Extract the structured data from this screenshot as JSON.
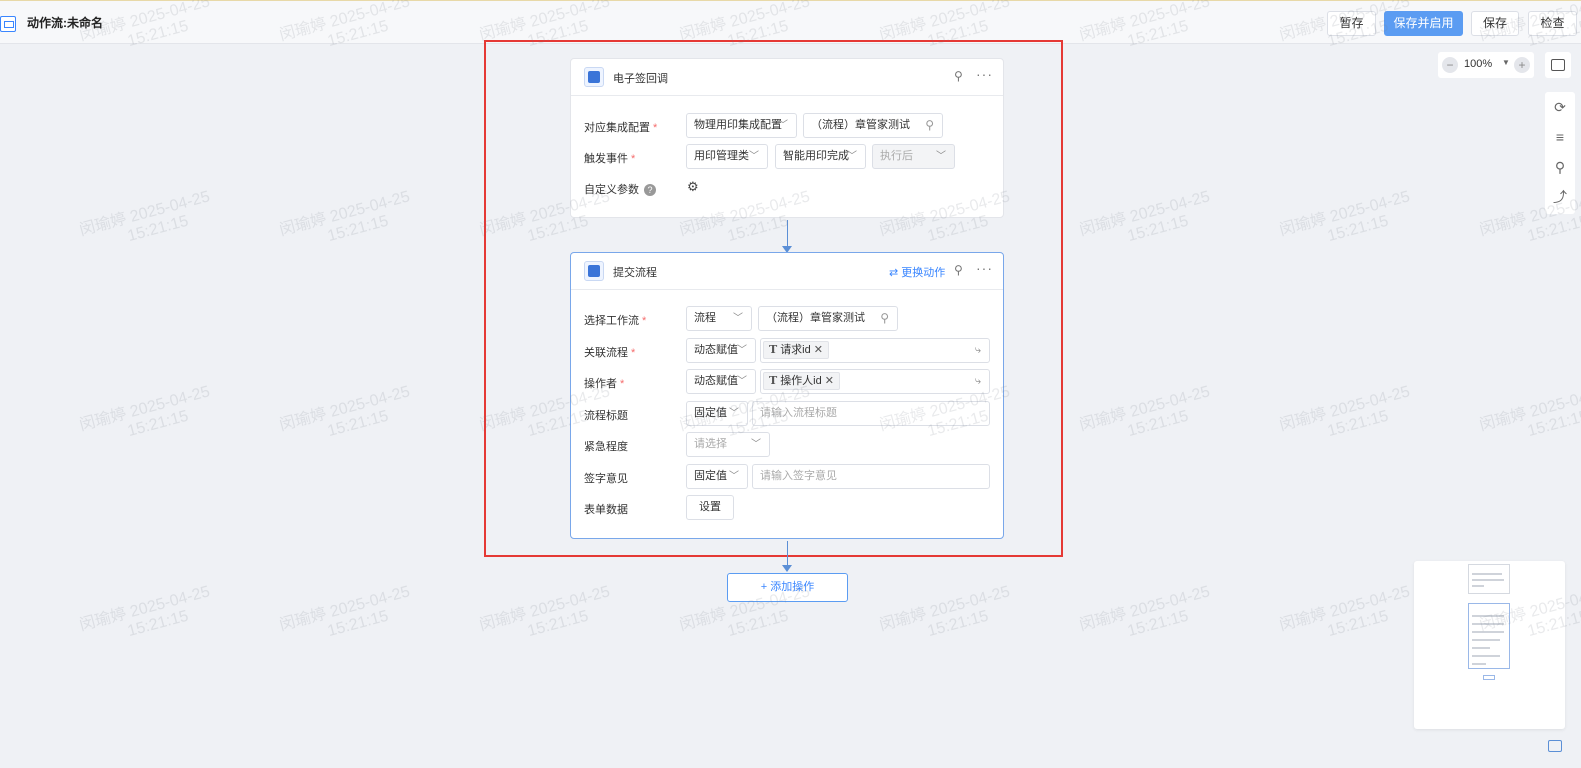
{
  "app": {
    "title": "动作流:未命名",
    "zoom": "100%"
  },
  "toolbar": {
    "temp_save": "暂存",
    "save_enable": "保存并启用",
    "save": "保存",
    "check": "检查"
  },
  "card1": {
    "title": "电子签回调",
    "rows": {
      "integration_label": "对应集成配置",
      "integration_select": "物理用印集成配置",
      "integration_search": "（流程）章管家测试",
      "trigger_label": "触发事件",
      "trigger_category": "用印管理类",
      "trigger_event": "智能用印完成",
      "trigger_timing": "执行后",
      "custom_params_label": "自定义参数"
    }
  },
  "card2": {
    "title": "提交流程",
    "swap_action": "更换动作",
    "rows": {
      "workflow_label": "选择工作流",
      "workflow_type": "流程",
      "workflow_search": "（流程）章管家测试",
      "related_label": "关联流程",
      "related_mode": "动态赋值",
      "related_tag": "请求id",
      "operator_label": "操作者",
      "operator_mode": "动态赋值",
      "operator_tag": "操作人id",
      "flow_title_label": "流程标题",
      "flow_title_mode": "固定值",
      "flow_title_placeholder": "请输入流程标题",
      "urgency_label": "紧急程度",
      "urgency_placeholder": "请选择",
      "sign_label": "签字意见",
      "sign_mode": "固定值",
      "sign_placeholder": "请输入签字意见",
      "form_label": "表单数据",
      "form_button": "设置"
    }
  },
  "add_action": "+ 添加操作",
  "watermark": {
    "name": "闵瑜婷",
    "date": "2025-04-25",
    "time": "15:21:15"
  }
}
